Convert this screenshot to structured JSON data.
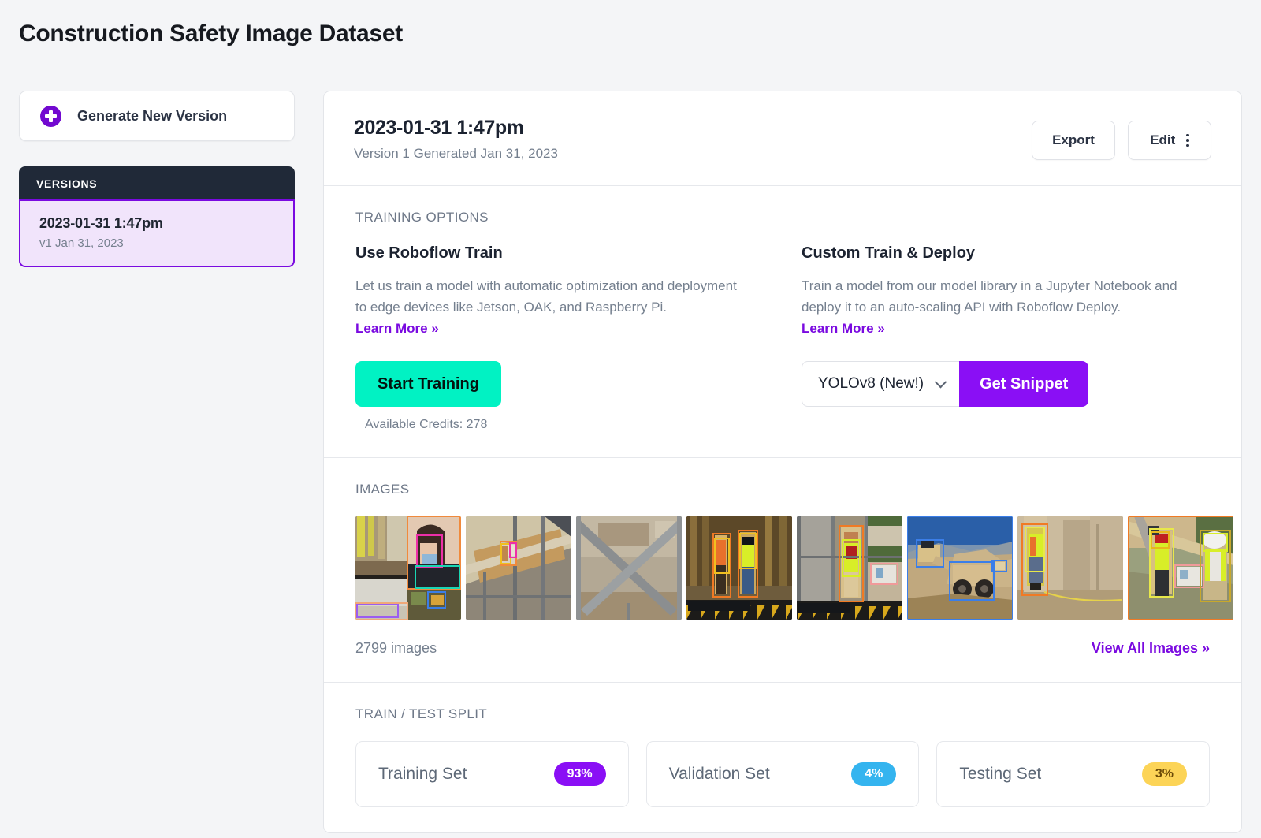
{
  "page": {
    "title": "Construction Safety Image Dataset"
  },
  "sidebar": {
    "generate_button": {
      "label": "Generate New Version",
      "icon": "plus-circle-icon"
    },
    "versions_header": "VERSIONS",
    "versions": [
      {
        "title": "2023-01-31 1:47pm",
        "subtitle": "v1 Jan 31, 2023",
        "selected": true
      }
    ]
  },
  "version_header": {
    "title": "2023-01-31 1:47pm",
    "subtitle": "Version 1 Generated Jan 31, 2023",
    "export_label": "Export",
    "edit_label": "Edit",
    "edit_menu_icon": "kebab-menu-icon"
  },
  "training_options": {
    "section_label": "TRAINING OPTIONS",
    "roboflow_train": {
      "title": "Use Roboflow Train",
      "description": "Let us train a model with automatic optimization and deployment to edge devices like Jetson, OAK, and Raspberry Pi. ",
      "learn_more": "Learn More »",
      "button_label": "Start Training",
      "credits": "Available Credits: 278"
    },
    "custom_train": {
      "title": "Custom Train & Deploy",
      "description": "Train a model from our model library in a Jupyter Notebook and deploy it to an auto-scaling API with Roboflow Deploy. ",
      "learn_more": "Learn More »",
      "model_selected": "YOLOv8 (New!)",
      "model_dropdown_icon": "chevron-down-icon",
      "snippet_button_label": "Get Snippet"
    }
  },
  "images": {
    "section_label": "IMAGES",
    "count_label": "2799 images",
    "view_all_label": "View All Images »",
    "thumbnails": [
      {
        "name": "thumb-interior-framing-person-mask"
      },
      {
        "name": "thumb-scaffolding-exterior"
      },
      {
        "name": "thumb-scaffold-cross-brace"
      },
      {
        "name": "thumb-framing-two-workers-vest"
      },
      {
        "name": "thumb-scaffold-worker-harness"
      },
      {
        "name": "thumb-excavator-dump-truck"
      },
      {
        "name": "thumb-interior-worker-vest-door"
      },
      {
        "name": "thumb-roof-framing-workers"
      }
    ]
  },
  "train_test_split": {
    "section_label": "TRAIN / TEST SPLIT",
    "sets": [
      {
        "name": "Training Set",
        "percent": "93%",
        "color": "#8a0ff5",
        "text_color": "#ffffff"
      },
      {
        "name": "Validation Set",
        "percent": "4%",
        "color": "#34b4ef",
        "text_color": "#ffffff"
      },
      {
        "name": "Testing Set",
        "percent": "3%",
        "color": "#fcd457",
        "text_color": "#6b4a07"
      }
    ]
  },
  "colors": {
    "brand_purple": "#8a0ff5",
    "accent_green": "#01f2c3",
    "dark_panel": "#202938",
    "page_bg": "#f4f5f7"
  }
}
